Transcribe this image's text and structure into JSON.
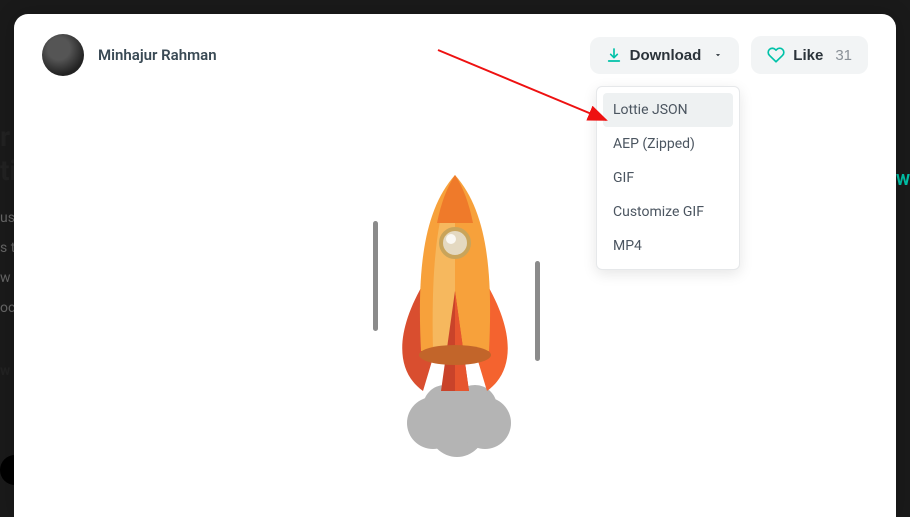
{
  "author": {
    "name": "Minhajur Rahman"
  },
  "download": {
    "label": "Download"
  },
  "like": {
    "label": "Like",
    "count": "31"
  },
  "dropdown": {
    "items": [
      {
        "label": "Lottie JSON"
      },
      {
        "label": "AEP (Zipped)"
      },
      {
        "label": "GIF"
      },
      {
        "label": "Customize GIF"
      },
      {
        "label": "MP4"
      }
    ]
  },
  "bg": {
    "line1": "r",
    "line2": "ti",
    "p1": "us",
    "p2": "s t",
    "p3": "w",
    "p4": "oc",
    "bold": "w",
    "rightW": "W"
  }
}
